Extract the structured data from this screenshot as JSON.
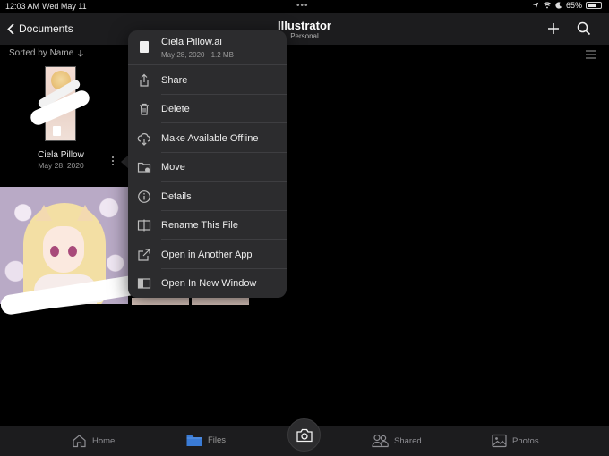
{
  "status_bar": {
    "time": "12:03 AM",
    "date": "Wed May 11",
    "multitask_dots": "•••",
    "battery": "65%",
    "battery_level": 0.65
  },
  "nav": {
    "back_label": "Documents",
    "title": "Illustrator",
    "subtitle": "Personal"
  },
  "sort": {
    "label": "Sorted by Name"
  },
  "files": [
    {
      "name": "Ciela Pillow",
      "date": "May 28, 2020"
    }
  ],
  "context_menu": {
    "file_name": "Ciela Pillow.ai",
    "file_meta": "May 28, 2020 · 1.2 MB",
    "items": [
      {
        "label": "Share",
        "icon": "share-icon"
      },
      {
        "label": "Delete",
        "icon": "trash-icon"
      },
      {
        "label": "Make Available Offline",
        "icon": "cloud-download-icon"
      },
      {
        "label": "Move",
        "icon": "folder-move-icon"
      },
      {
        "label": "Details",
        "icon": "info-icon"
      },
      {
        "label": "Rename This File",
        "icon": "rename-icon"
      },
      {
        "label": "Open in Another App",
        "icon": "open-external-icon"
      },
      {
        "label": "Open In New Window",
        "icon": "new-window-icon"
      }
    ]
  },
  "tab_bar": {
    "tabs": [
      {
        "label": "Home",
        "icon": "home-icon",
        "active": false
      },
      {
        "label": "Files",
        "icon": "folder-icon",
        "active": true
      },
      {
        "label": "Shared",
        "icon": "people-icon",
        "active": false
      },
      {
        "label": "Photos",
        "icon": "photo-icon",
        "active": false
      }
    ],
    "camera_icon": "camera-icon"
  },
  "colors": {
    "background": "#000000",
    "bar": "#1c1c1e",
    "menu": "#2c2c2e",
    "accent_folder": "#3a7bd5"
  }
}
